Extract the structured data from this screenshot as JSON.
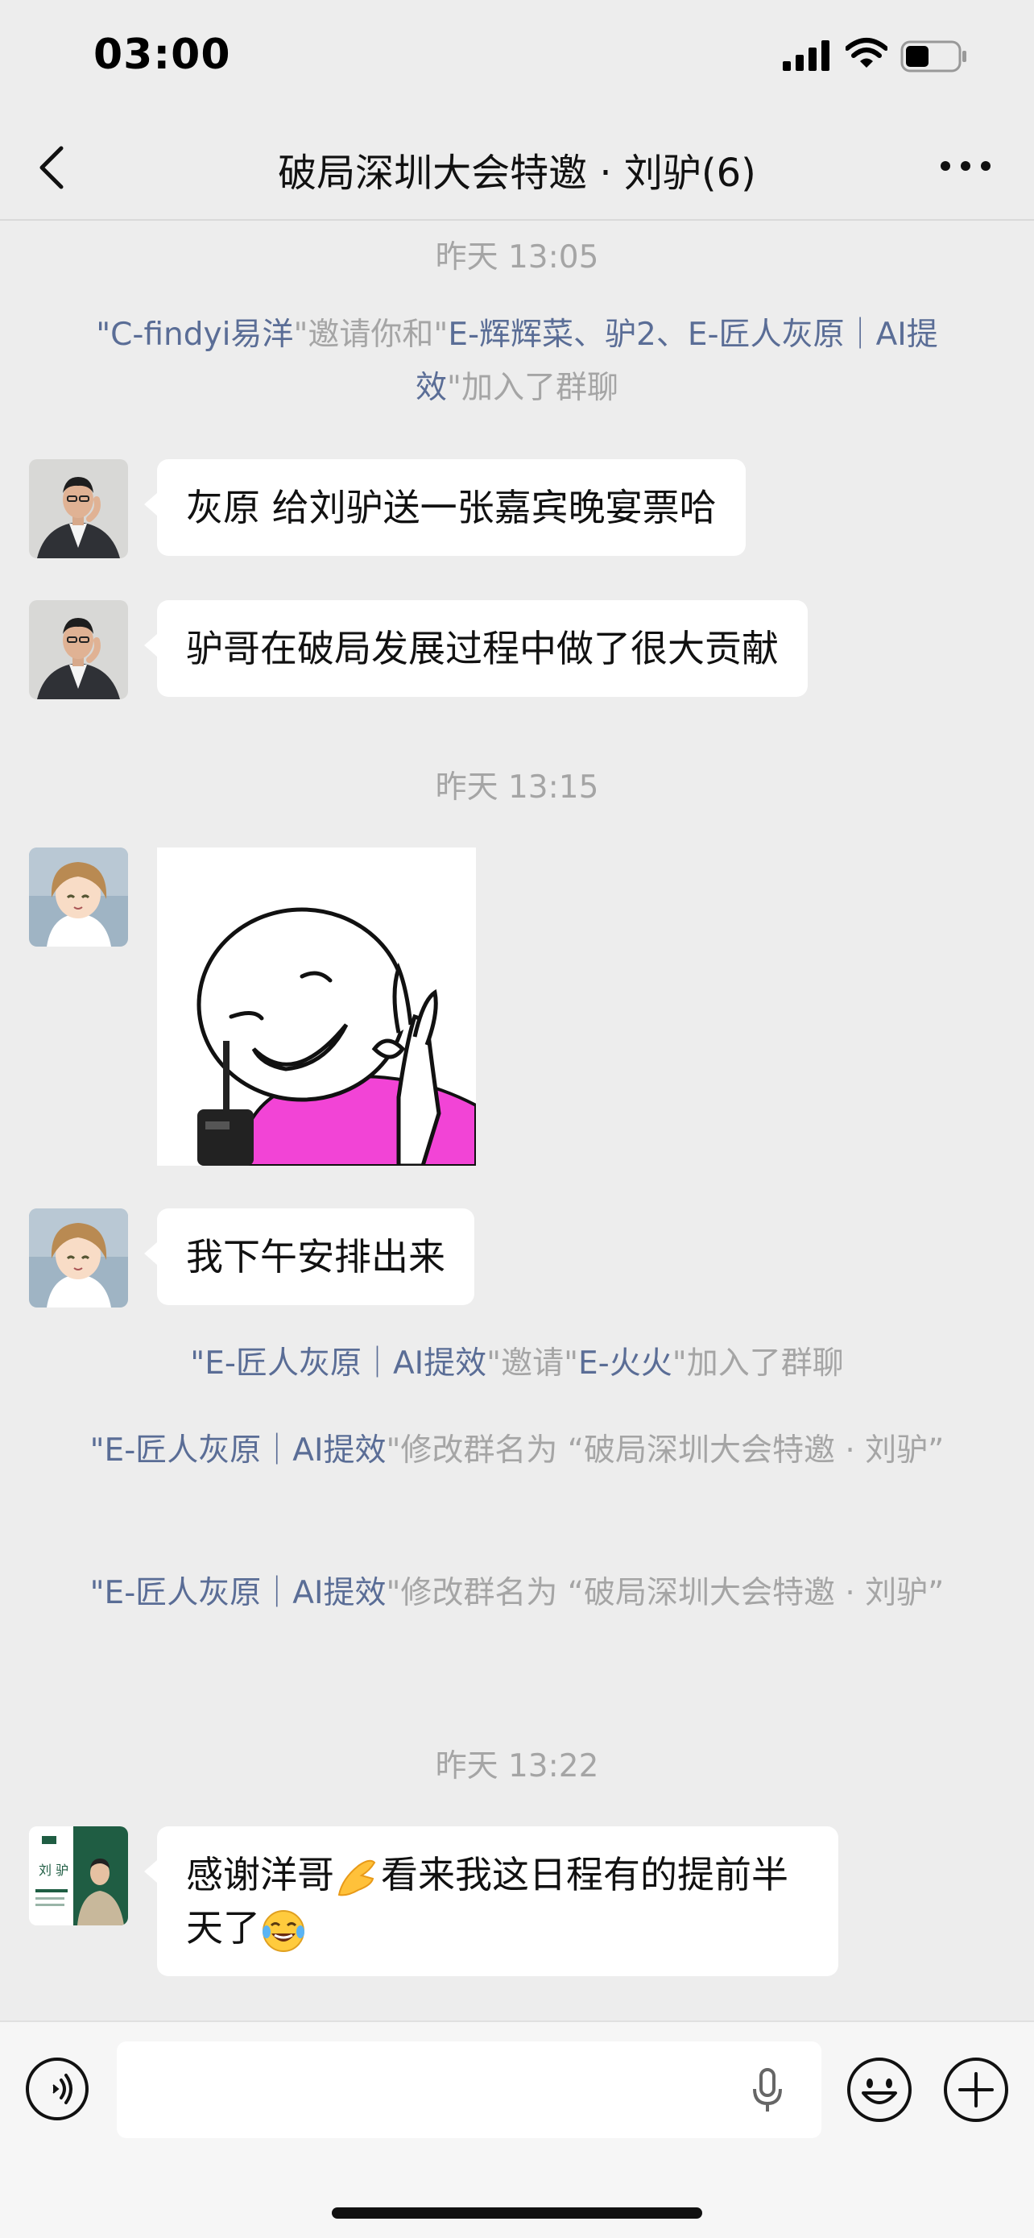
{
  "status_bar": {
    "time": "03:00",
    "battery_level": 0.45
  },
  "header": {
    "title": "破局深圳大会特邀 · 刘驴(6)"
  },
  "messages": {
    "ts1": "昨天 13:05",
    "sys1": {
      "q1": "\"",
      "name1": "C-findyi易洋",
      "mid": "\"邀请你和\"",
      "name2": "E-辉辉菜、驴2、E-匠人灰原｜AI提效",
      "tail": "\"加入了群聊"
    },
    "msg1": "灰原 给刘驴送一张嘉宾晚宴票哈",
    "msg2": "驴哥在破局发展过程中做了很大贡献",
    "ts2": "昨天 13:15",
    "msg3": "我下午安排出来",
    "sys2": {
      "q1": "\"",
      "name1": "E-匠人灰原｜AI提效",
      "mid": "\"邀请\"",
      "name2": "E-火火",
      "tail": "\"加入了群聊"
    },
    "sys3": {
      "q1": "\"",
      "name1": "E-匠人灰原｜AI提效",
      "tail": "\"修改群名为 “破局深圳大会特邀 · 刘驴”"
    },
    "sys4": {
      "q1": "\"",
      "name1": "E-匠人灰原｜AI提效",
      "tail": "\"修改群名为 “破局深圳大会特邀 · 刘驴”"
    },
    "ts3": "昨天 13:22",
    "msg4": {
      "a": "感谢洋哥",
      "b": "看来我这日程有的提前半天了"
    },
    "avatar4_text": "刘 驴"
  },
  "colors": {
    "name_link": "#5a6d96",
    "system_text": "#a5a5a5",
    "background": "#ededed",
    "bubble": "#ffffff",
    "sticker_shirt": "#f244d6"
  },
  "icons": [
    "back-icon",
    "more-icon",
    "voice-icon",
    "mic-icon",
    "emoji-icon",
    "plus-icon"
  ]
}
